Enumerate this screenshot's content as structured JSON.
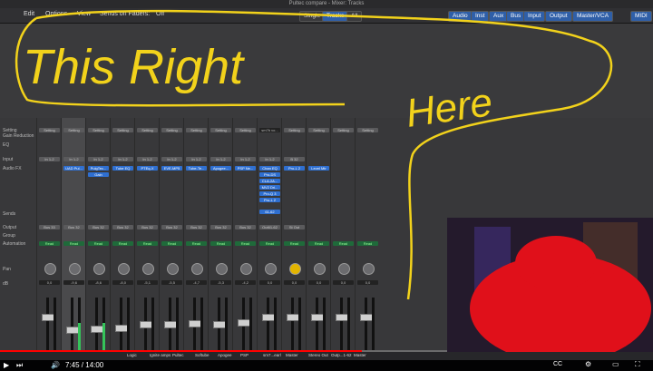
{
  "window": {
    "title": "Pultec compare - Mixer: Tracks"
  },
  "menubar": {
    "edit": "Edit",
    "options": "Options",
    "view": "View",
    "sends_on_faders_label": "Sends on Faders:",
    "sends_on_faders_value": "Off",
    "view_modes": [
      "Single",
      "Tracks",
      "All"
    ],
    "filters": [
      "Audio",
      "Inst",
      "Aux",
      "Bus",
      "Input",
      "Output",
      "Master/VCA",
      "MIDI"
    ]
  },
  "annotation": {
    "line1": "This Right",
    "line2": "Here"
  },
  "row_labels": [
    "Setting",
    "Gain Reduction",
    "EQ",
    "Input",
    "Audio FX",
    "Sends",
    "Output",
    "Group",
    "Automation",
    "Pan",
    "dB"
  ],
  "strips": [
    {
      "setting": "Setting",
      "input": "In 1-2",
      "fx": [],
      "output": "Bus 33",
      "auto": "Read",
      "db": "0,0"
    },
    {
      "setting": "Setting",
      "input": "In 1-2",
      "fx": [
        "UAD Pul..."
      ],
      "output": "Bus 32",
      "auto": "Read",
      "db": "-9,6"
    },
    {
      "setting": "Setting",
      "input": "In 1-2",
      "fx": [
        "PulgTec...",
        "Gain"
      ],
      "output": "Bus 32",
      "auto": "Read",
      "db": "-8,6"
    },
    {
      "setting": "Setting",
      "input": "In 1-2",
      "fx": [
        "Tube EQ"
      ],
      "output": "Bus 32",
      "auto": "Read",
      "db": "-8,0"
    },
    {
      "setting": "Setting",
      "input": "In 1-2",
      "fx": [
        "PTEq-X"
      ],
      "output": "Bus 32",
      "auto": "Read",
      "db": "-5,1"
    },
    {
      "setting": "Setting",
      "input": "In 1-2",
      "fx": [
        "EVE-MP5"
      ],
      "output": "Bus 32",
      "auto": "Read",
      "db": "-5,5"
    },
    {
      "setting": "Setting",
      "input": "In 1-2",
      "fx": [
        "Tube-Te..."
      ],
      "output": "Bus 32",
      "auto": "Read",
      "db": "-4,7"
    },
    {
      "setting": "Setting",
      "input": "In 1-2",
      "fx": [
        "Apogee..."
      ],
      "output": "Bus 32",
      "auto": "Read",
      "db": "-5,3"
    },
    {
      "setting": "Setting",
      "input": "In 1-2",
      "fx": [
        "PSP Ne..."
      ],
      "output": "Bus 32",
      "auto": "Read",
      "db": "-4,2"
    },
    {
      "setting": "sm7b vo...",
      "input": "In 1-2",
      "fx": [
        "Chan EQ",
        "Pro-DS",
        "CLA-2A...",
        "MV2 Dri...",
        "Pro-Q 3",
        "Pro-L 2"
      ],
      "output": "Out61-62",
      "auto": "Read",
      "db": "0,0"
    },
    {
      "setting": "Setting",
      "input": "B 32",
      "fx": [
        "Pro-L 2"
      ],
      "output": "St Out",
      "auto": "Read",
      "db": "0,0"
    },
    {
      "setting": "Setting",
      "input": "",
      "fx": [
        "Level Mtr"
      ],
      "output": "",
      "auto": "Read",
      "db": "0,0"
    },
    {
      "setting": "Setting",
      "input": "",
      "fx": [],
      "output": "",
      "auto": "Read",
      "db": "0,0"
    },
    {
      "setting": "Setting",
      "input": "",
      "fx": [],
      "output": "",
      "auto": "Read",
      "db": "0,0"
    }
  ],
  "sends": {
    "strip10": "61-62"
  },
  "bottom_names": [
    "Logic",
    "Ignite amps",
    "Pultec",
    "Softube",
    "Apogee",
    "PSP",
    "sm7...earl",
    "Master",
    "Stereo Out",
    "Outp...1-62",
    "Master"
  ],
  "player": {
    "time": "7:45 / 14:00",
    "progress_fraction": 0.554
  },
  "colors": {
    "accent": "#2f6fd0",
    "annotation": "#f2d21b",
    "redaction": "#e0101a"
  }
}
